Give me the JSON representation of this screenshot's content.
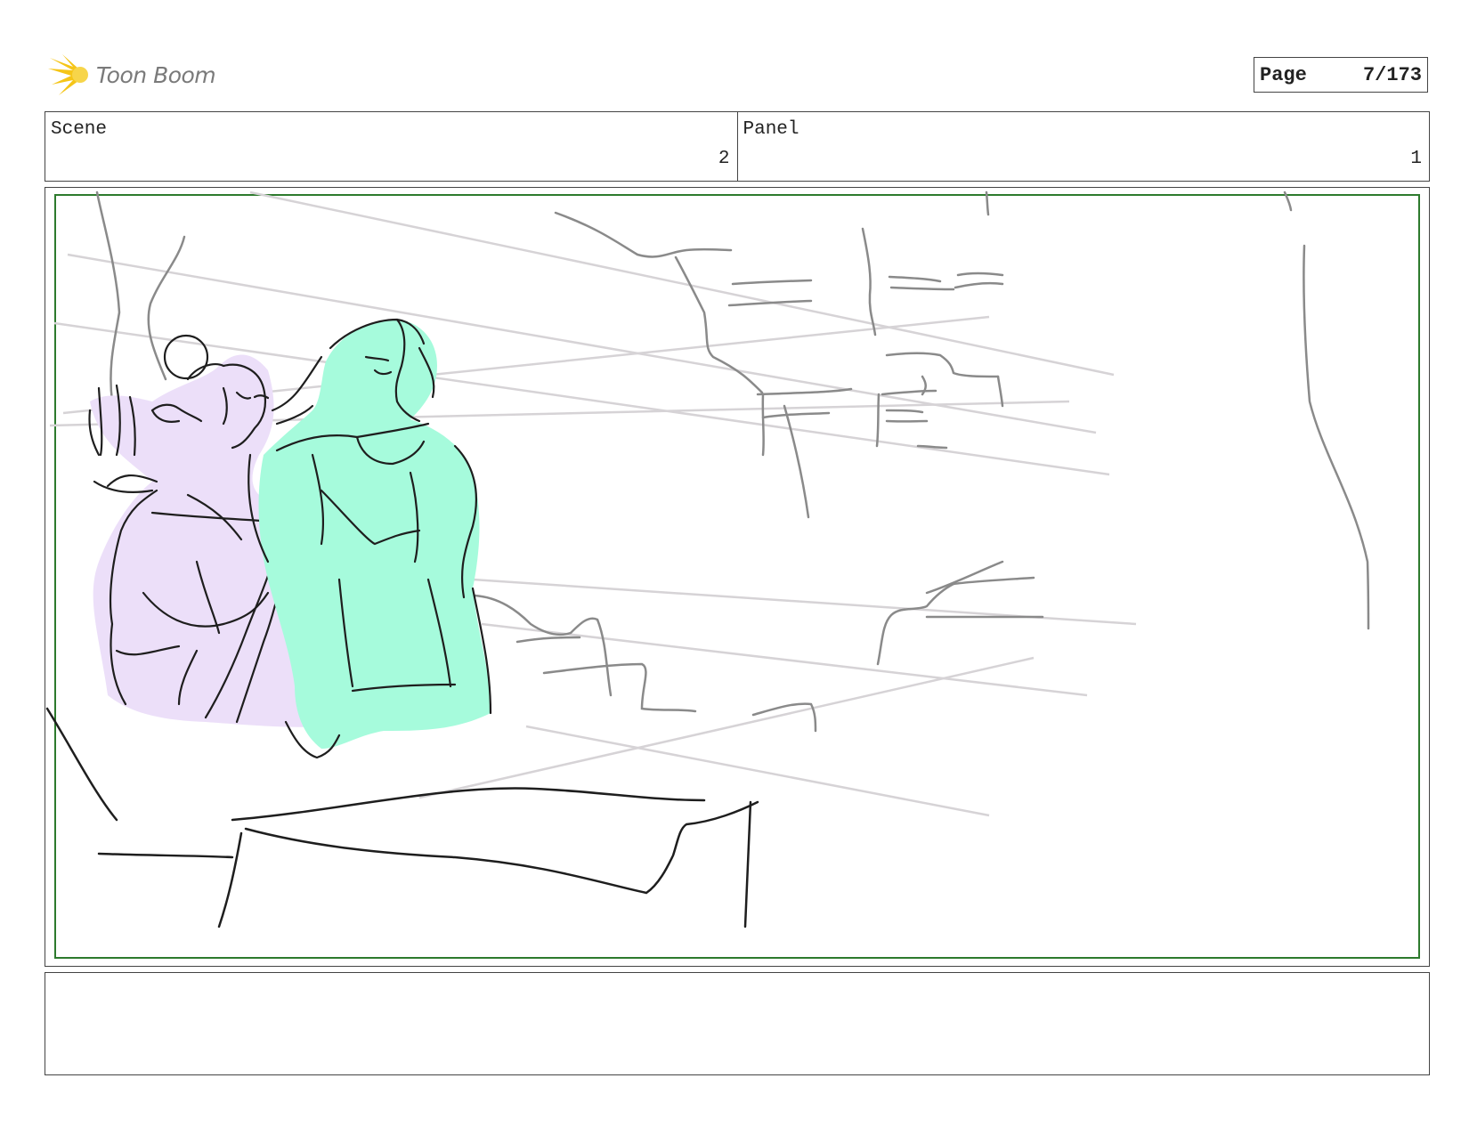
{
  "header": {
    "logo_text": "Toon Boom",
    "logo_icon": "starburst-logo-icon",
    "page_label": "Page",
    "page_value": "7/173"
  },
  "scene": {
    "label": "Scene",
    "value": "2"
  },
  "panel": {
    "label": "Panel",
    "value": "1"
  },
  "drawing": {
    "description_icon": "storyboard-sketch",
    "colors": {
      "safe_frame": "#2d7a2d",
      "character_left_fill": "#ecdff9",
      "character_right_fill": "#a6fbdc",
      "ink": "#1e1e1e",
      "background_lines": "#8a8a8a",
      "guide_lines": "#d6d3d6"
    }
  },
  "notes": {
    "text": ""
  }
}
